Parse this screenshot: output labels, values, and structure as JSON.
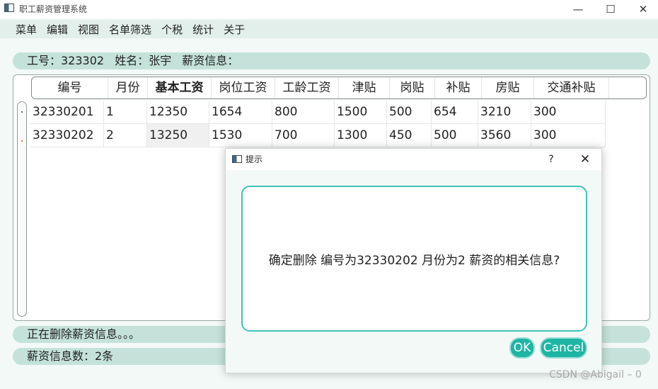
{
  "window": {
    "title": "职工薪资管理系统",
    "minimize": "—",
    "maximize": "☐",
    "close": "✕"
  },
  "menu": [
    "菜单",
    "编辑",
    "视图",
    "名单筛选",
    "个税",
    "统计",
    "关于"
  ],
  "info": {
    "id_label": "工号：323302",
    "name_label": "姓名：张宇",
    "salary_label": "薪资信息："
  },
  "table": {
    "headers": [
      "编号",
      "月份",
      "基本工资",
      "岗位工资",
      "工龄工资",
      "津贴",
      "岗贴",
      "补贴",
      "房贴",
      "交通补贴"
    ],
    "rows": [
      [
        "32330201",
        "1",
        "12350",
        "1654",
        "800",
        "1500",
        "500",
        "654",
        "3210",
        "300"
      ],
      [
        "32330202",
        "2",
        "13250",
        "1530",
        "700",
        "1300",
        "450",
        "500",
        "3560",
        "300"
      ]
    ]
  },
  "status": {
    "message": "正在删除薪资信息。。。"
  },
  "count": {
    "label": "薪资信息数：2条"
  },
  "dialog": {
    "title": "提示",
    "help": "?",
    "close": "✕",
    "message": "确定删除 编号为32330202 月份为2 薪资的相关信息?",
    "ok": "OK",
    "cancel": "Cancel"
  },
  "watermark": "CSDN @Abigail – 0",
  "colors": {
    "accent": "#1fb5a4",
    "pill": "#c4e2d9",
    "menubar": "#e2efea",
    "dialog_border": "#3bc4b6"
  }
}
